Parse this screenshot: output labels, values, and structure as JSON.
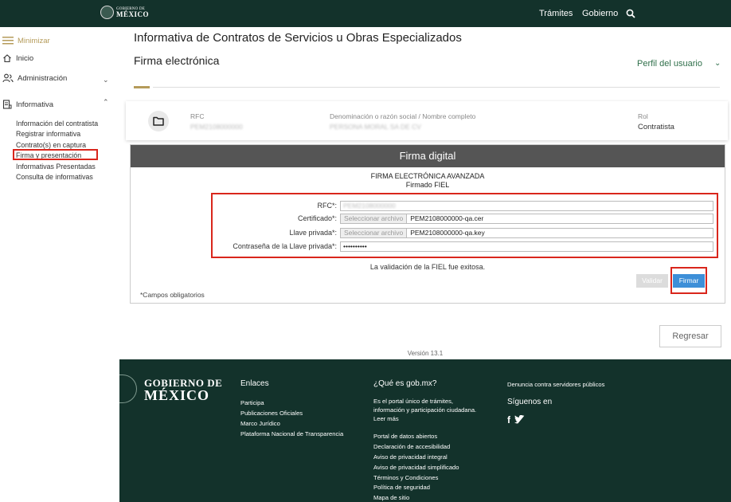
{
  "header": {
    "logo_small": "GOBIERNO DE",
    "logo_big": "MÉXICO",
    "nav": [
      "Trámites",
      "Gobierno"
    ]
  },
  "sidebar": {
    "minimize": "Minimizar",
    "items": [
      {
        "label": "Inicio"
      },
      {
        "label": "Administración"
      },
      {
        "label": "Informativa"
      }
    ],
    "subitems": [
      "Información del contratista",
      "Registrar informativa",
      "Contrato(s) en captura",
      "Firma y presentación",
      "Informativas Presentadas",
      "Consulta de informativas"
    ]
  },
  "main": {
    "title": "Informativa de Contratos de Servicios u Obras Especializados",
    "subtitle": "Firma electrónica",
    "profile_menu": "Perfil del usuario"
  },
  "info_card": {
    "rfc_label": "RFC",
    "rfc_value": "PEM2108000000",
    "name_label": "Denominación o razón social / Nombre completo",
    "name_value": "PERSONA MORAL SA DE CV",
    "role_label": "Rol",
    "role_value": "Contratista"
  },
  "firma": {
    "header": "Firma digital",
    "line1": "FIRMA ELECTRÓNICA AVANZADA",
    "line2": "Firmado FIEL",
    "fields": {
      "rfc_label": "RFC*:",
      "rfc_value": "PEM2108000000",
      "cert_label": "Certificado*:",
      "file_btn": "Seleccionar archivo",
      "cert_value": "PEM2108000000-qa.cer",
      "key_label": "Llave privada*:",
      "key_value": "PEM2108000000-qa.key",
      "pass_label": "Contraseña de la Llave privada*:",
      "pass_value": "••••••••••"
    },
    "validation": "La validación de la FIEL fue exitosa.",
    "validate_btn": "Validar",
    "sign_btn": "Firmar",
    "required_note": "*Campos obligatorios"
  },
  "back_btn": "Regresar",
  "version": "Versión 13.1",
  "footer": {
    "logo_line1": "GOBIERNO DE",
    "logo_line2": "MÉXICO",
    "enlaces": {
      "title": "Enlaces",
      "links": [
        "Participa",
        "Publicaciones Oficiales",
        "Marco Jurídico",
        "Plataforma Nacional de Transparencia"
      ]
    },
    "que_es": {
      "title": "¿Qué es gob.mx?",
      "desc1": "Es el portal único de trámites,",
      "desc2": "información y participación ciudadana.",
      "more": "Leer más",
      "links": [
        "Portal de datos abiertos",
        "Declaración de accesibilidad",
        "Aviso de privacidad integral",
        "Aviso de privacidad simplificado",
        "Términos y Condiciones",
        "Política de seguridad",
        "Mapa de sitio"
      ]
    },
    "denuncia": "Denuncia contra servidores públicos",
    "siguenos": "Síguenos en",
    "social": {
      "facebook": "f"
    }
  }
}
